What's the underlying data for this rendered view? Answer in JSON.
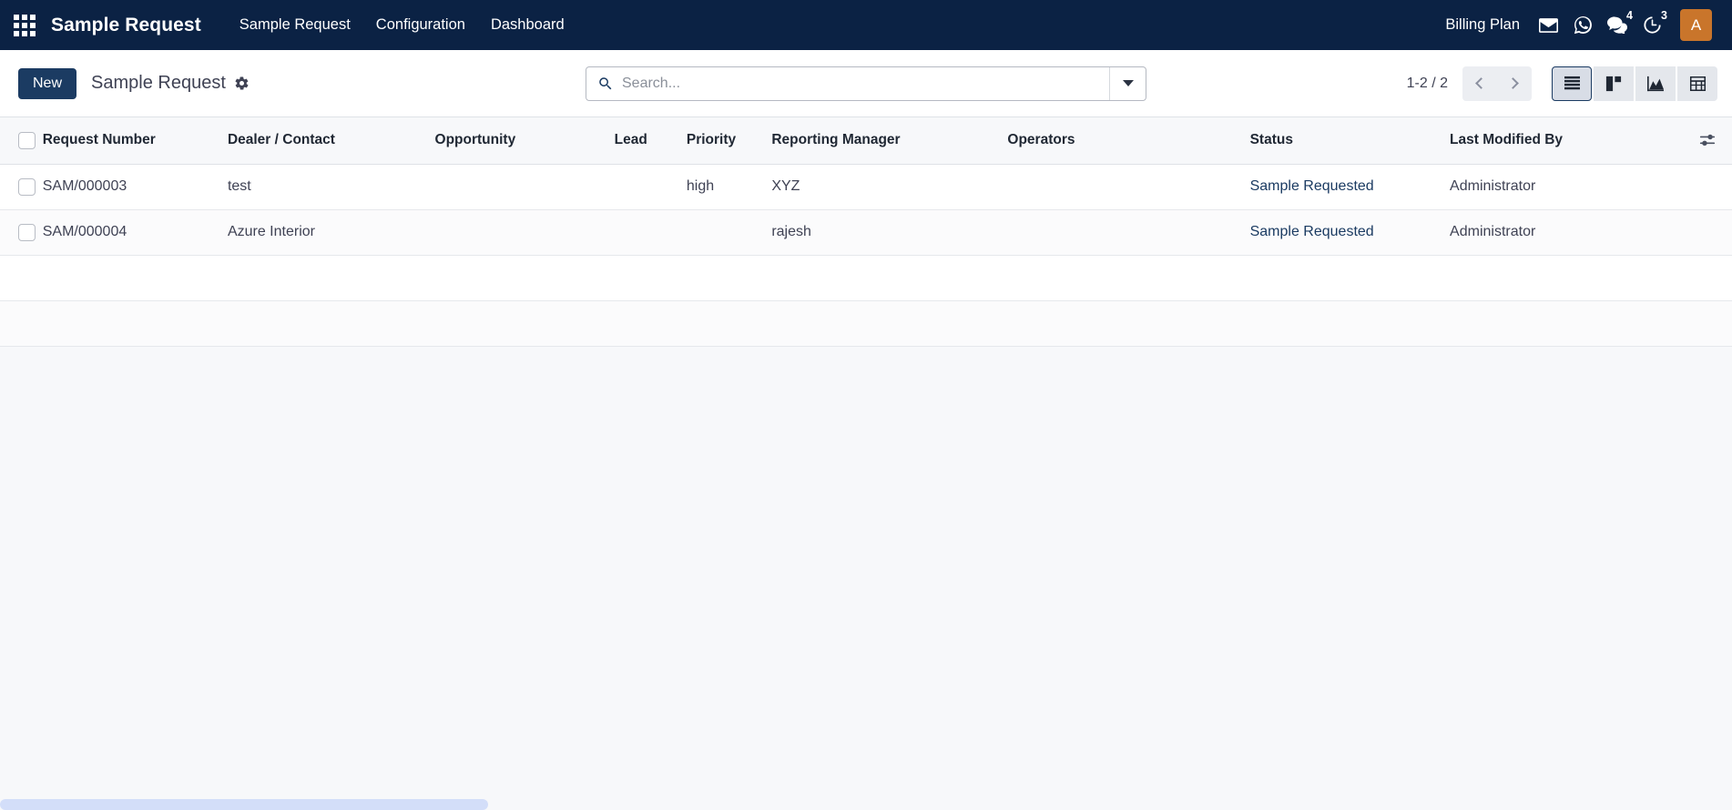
{
  "navbar": {
    "apps_icon": "apps-grid-icon",
    "brand": "Sample Request",
    "menu": [
      {
        "label": "Sample Request"
      },
      {
        "label": "Configuration"
      },
      {
        "label": "Dashboard"
      }
    ],
    "billing_plan": "Billing Plan",
    "icons": [
      {
        "name": "mail-icon",
        "badge": ""
      },
      {
        "name": "whatsapp-icon",
        "badge": ""
      },
      {
        "name": "messages-icon",
        "badge": "4"
      },
      {
        "name": "activities-clock-icon",
        "badge": "3"
      }
    ],
    "avatar_initial": "A",
    "bg_color": "#0b2244",
    "avatar_color": "#c9752b"
  },
  "control_panel": {
    "new_button": "New",
    "breadcrumb": "Sample Request",
    "gear_icon": "gear-icon",
    "search": {
      "placeholder": "Search...",
      "value": "",
      "icon": "search-icon",
      "dropdown_icon": "chevron-down-icon"
    },
    "pager": "1-2 / 2",
    "prev_label": "Previous",
    "next_label": "Next",
    "views": [
      {
        "name": "list-view",
        "label": "List",
        "active": true
      },
      {
        "name": "kanban-view",
        "label": "Kanban",
        "active": false
      },
      {
        "name": "graph-view",
        "label": "Graph",
        "active": false
      },
      {
        "name": "pivot-view",
        "label": "Pivot",
        "active": false
      }
    ]
  },
  "table": {
    "columns": [
      "Request Number",
      "Dealer / Contact",
      "Opportunity",
      "Lead",
      "Priority",
      "Reporting Manager",
      "Operators",
      "Status",
      "Last Modified By"
    ],
    "optional_columns_icon": "sliders-icon",
    "rows": [
      {
        "request_number": "SAM/000003",
        "dealer_contact": "test",
        "opportunity": "",
        "lead": "",
        "priority": "high",
        "reporting_manager": "XYZ",
        "operators": "",
        "status": "Sample Requested",
        "last_modified_by": "Administrator"
      },
      {
        "request_number": "SAM/000004",
        "dealer_contact": "Azure Interior",
        "opportunity": "",
        "lead": "",
        "priority": "",
        "reporting_manager": "rajesh",
        "operators": "",
        "status": "Sample Requested",
        "last_modified_by": "Administrator"
      }
    ],
    "status_color": "#1b3b62"
  },
  "scrollbar": {
    "name": "horizontal-scrollbar",
    "thumb_color": "#d3def9"
  }
}
